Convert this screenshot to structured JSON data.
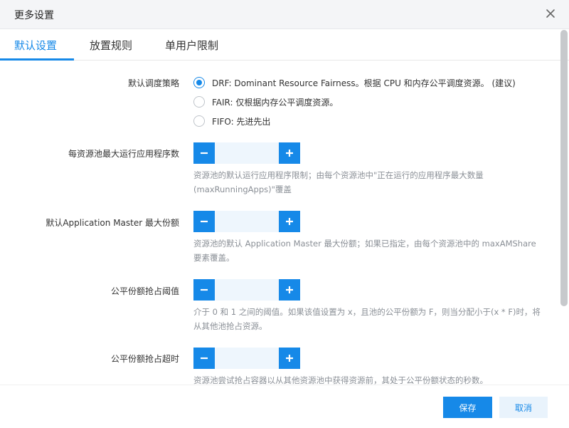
{
  "dialog": {
    "title": "更多设置"
  },
  "tabs": [
    {
      "label": "默认设置",
      "active": true
    },
    {
      "label": "放置规则",
      "active": false
    },
    {
      "label": "单用户限制",
      "active": false
    }
  ],
  "scheduling_policy": {
    "label": "默认调度策略",
    "selected": "drf",
    "options": [
      {
        "id": "drf",
        "text": "DRF: Dominant Resource Fairness。根据 CPU 和内存公平调度资源。 (建议)"
      },
      {
        "id": "fair",
        "text": "FAIR: 仅根据内存公平调度资源。"
      },
      {
        "id": "fifo",
        "text": "FIFO: 先进先出"
      }
    ]
  },
  "max_running_apps": {
    "label": "每资源池最大运行应用程序数",
    "value": "",
    "help_line1": "资源池的默认运行应用程序限制；由每个资源池中\"正在运行的应用程序最大数量",
    "help_line2": "(maxRunningApps)\"覆盖"
  },
  "max_am_share": {
    "label": "默认Application Master 最大份额",
    "value": "",
    "help_line1": "资源池的默认 Application Master 最大份额；如果已指定，由每个资源池中的 maxAMShare",
    "help_line2": "要素覆盖。"
  },
  "preemption_threshold": {
    "label": "公平份额抢占阈值",
    "value": "",
    "help_line1": "介于 0 和 1 之间的阈值。如果该值设置为 x，且池的公平份额为 F，则当分配小于(x * F)时，将",
    "help_line2": "从其他池抢占资源。"
  },
  "preemption_timeout": {
    "label": "公平份额抢占超时",
    "value": "",
    "help_line1": "资源池尝试抢占容器以从其他资源池中获得资源前，其处于公平份额状态的秒数。"
  },
  "footer": {
    "save_label": "保存",
    "cancel_label": "取消"
  },
  "colors": {
    "accent": "#1689e8",
    "input_bg": "#eef6fd",
    "header_bg": "#f4f5f7"
  }
}
